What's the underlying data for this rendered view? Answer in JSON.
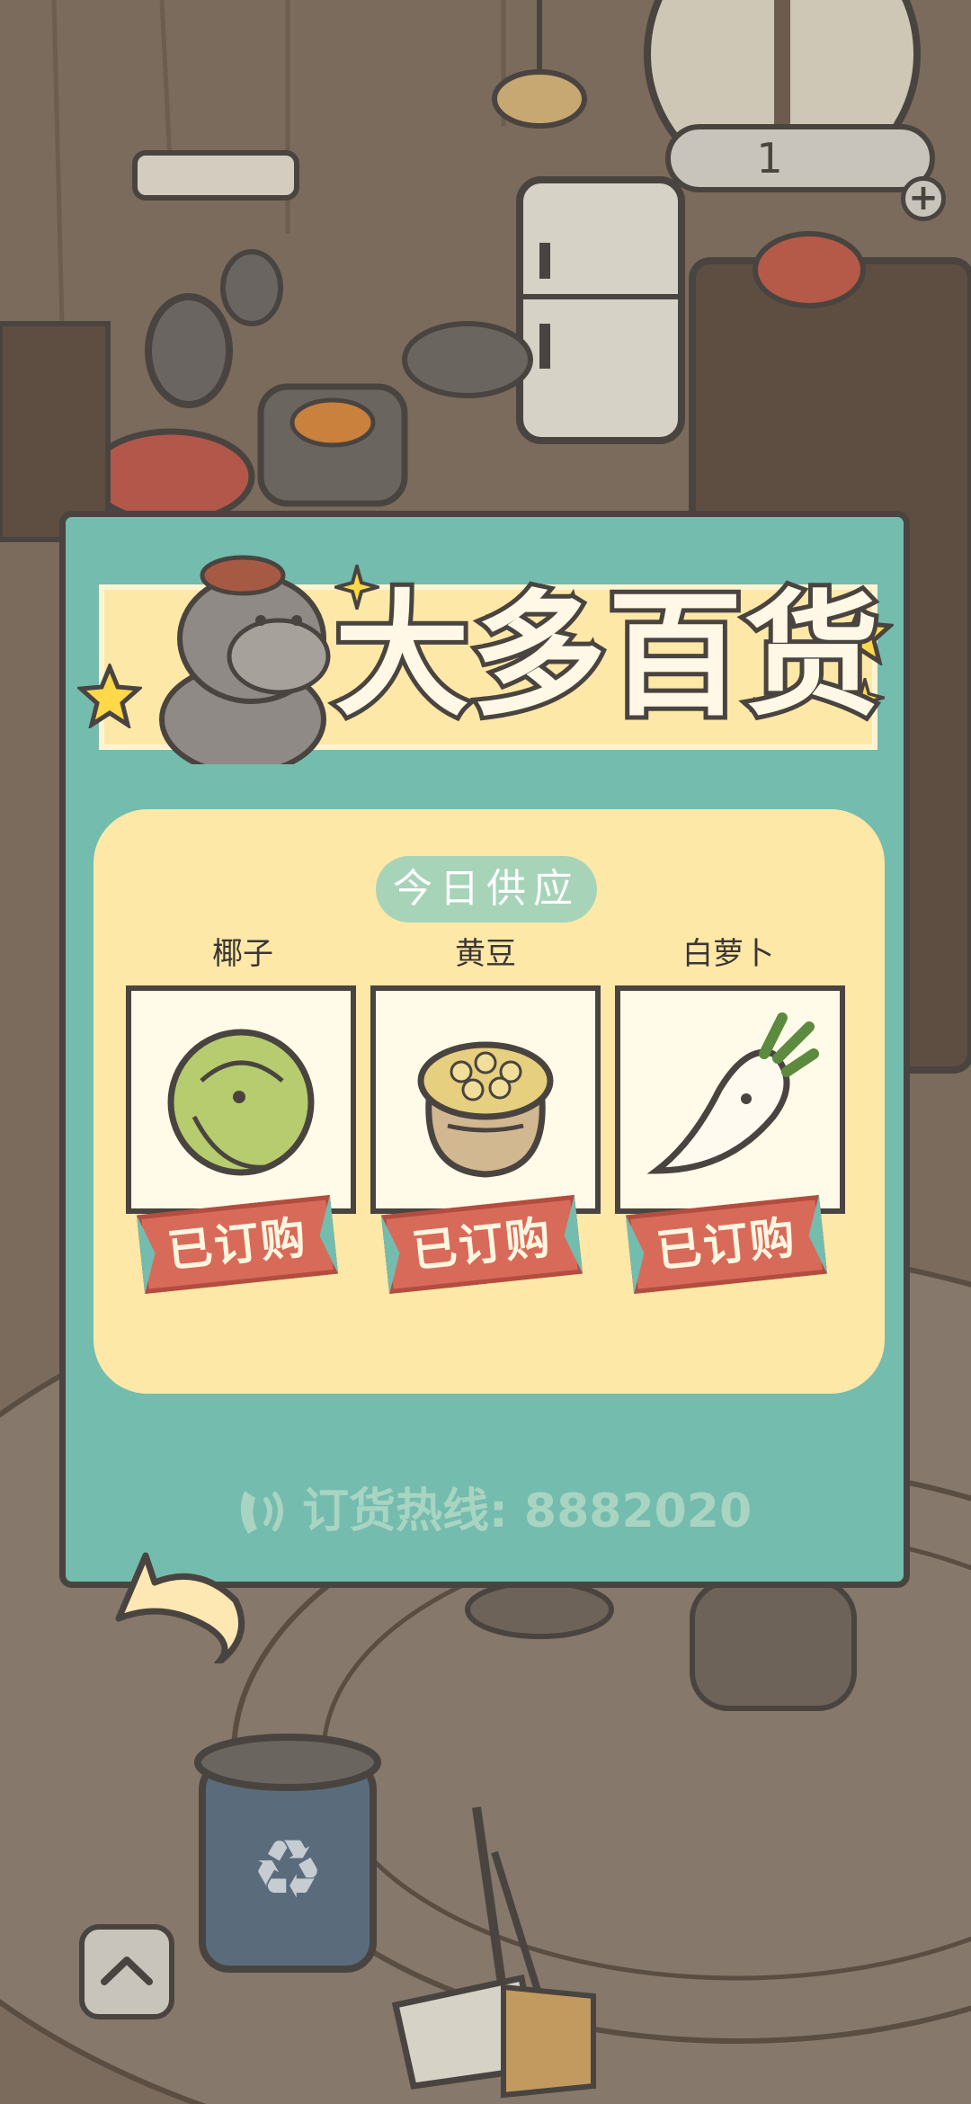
{
  "counter": {
    "value": "1",
    "plus_label": "+"
  },
  "shop": {
    "title": "大多百货",
    "today_label": "今日供应",
    "items": [
      {
        "name": "椰子",
        "status": "已订购",
        "icon": "coconut-icon"
      },
      {
        "name": "黄豆",
        "status": "已订购",
        "icon": "soybean-sack-icon"
      },
      {
        "name": "白萝卜",
        "status": "已订购",
        "icon": "daikon-radish-icon"
      }
    ],
    "hotline": "订货热线: 8882020"
  },
  "colors": {
    "panel": "#74bcae",
    "banner": "#fde8a8",
    "tag": "#d86a5a",
    "outline": "#4a4440"
  }
}
